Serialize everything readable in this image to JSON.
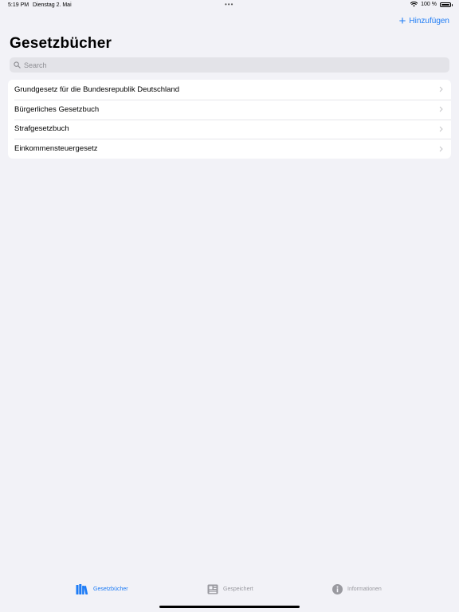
{
  "status_bar": {
    "time": "5:19 PM",
    "date": "Dienstag 2. Mai",
    "battery": "100 %"
  },
  "nav": {
    "add_label": "Hinzufügen",
    "title": "Gesetzbücher"
  },
  "search": {
    "placeholder": "Search"
  },
  "books": [
    "Grundgesetz für die Bundesrepublik Deutschland",
    "Bürgerliches Gesetzbuch",
    "Strafgesetzbuch",
    "Einkommensteuergesetz"
  ],
  "tabs": [
    {
      "label": "Gesetzbücher",
      "icon": "books-icon",
      "active": true
    },
    {
      "label": "Gespeichert",
      "icon": "saved-icon",
      "active": false
    },
    {
      "label": "Informationen",
      "icon": "info-icon",
      "active": false
    }
  ],
  "colors": {
    "accent": "#1e7cf6",
    "background": "#f2f2f7",
    "inactive": "#9a9aa0"
  }
}
